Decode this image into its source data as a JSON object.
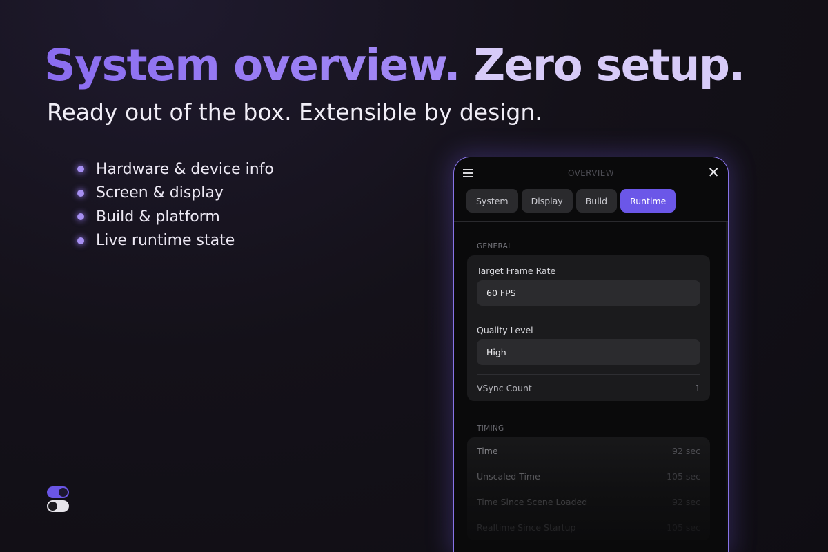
{
  "hero": {
    "headline_part1": "System overview.",
    "headline_part2": "Zero setup.",
    "subheadline": "Ready out of the box. Extensible by design."
  },
  "features": [
    "Hardware & device info",
    "Screen & display",
    "Build & platform",
    "Live runtime state"
  ],
  "panel": {
    "title": "OVERVIEW",
    "menu_icon": "hamburger-menu-icon",
    "close_icon": "close-icon",
    "close_glyph": "✕",
    "tabs": [
      {
        "label": "System",
        "active": false
      },
      {
        "label": "Display",
        "active": false
      },
      {
        "label": "Build",
        "active": false
      },
      {
        "label": "Runtime",
        "active": true
      }
    ],
    "general": {
      "label": "GENERAL",
      "target_frame_rate": {
        "label": "Target Frame Rate",
        "value": "60 FPS"
      },
      "quality_level": {
        "label": "Quality Level",
        "value": "High"
      },
      "vsync_count": {
        "label": "VSync Count",
        "value": "1"
      }
    },
    "timing": {
      "label": "TIMING",
      "rows": [
        {
          "label": "Time",
          "value": "92 sec"
        },
        {
          "label": "Unscaled Time",
          "value": "105 sec"
        },
        {
          "label": "Time Since Scene Loaded",
          "value": "92 sec"
        },
        {
          "label": "Realtime Since Startup",
          "value": "105 sec"
        }
      ]
    }
  },
  "colors": {
    "accent": "#6b57e8",
    "headline_gradient_start": "#8a6cf0",
    "headline_part2": "#d7cbf8",
    "panel_border": "#8773e8"
  }
}
